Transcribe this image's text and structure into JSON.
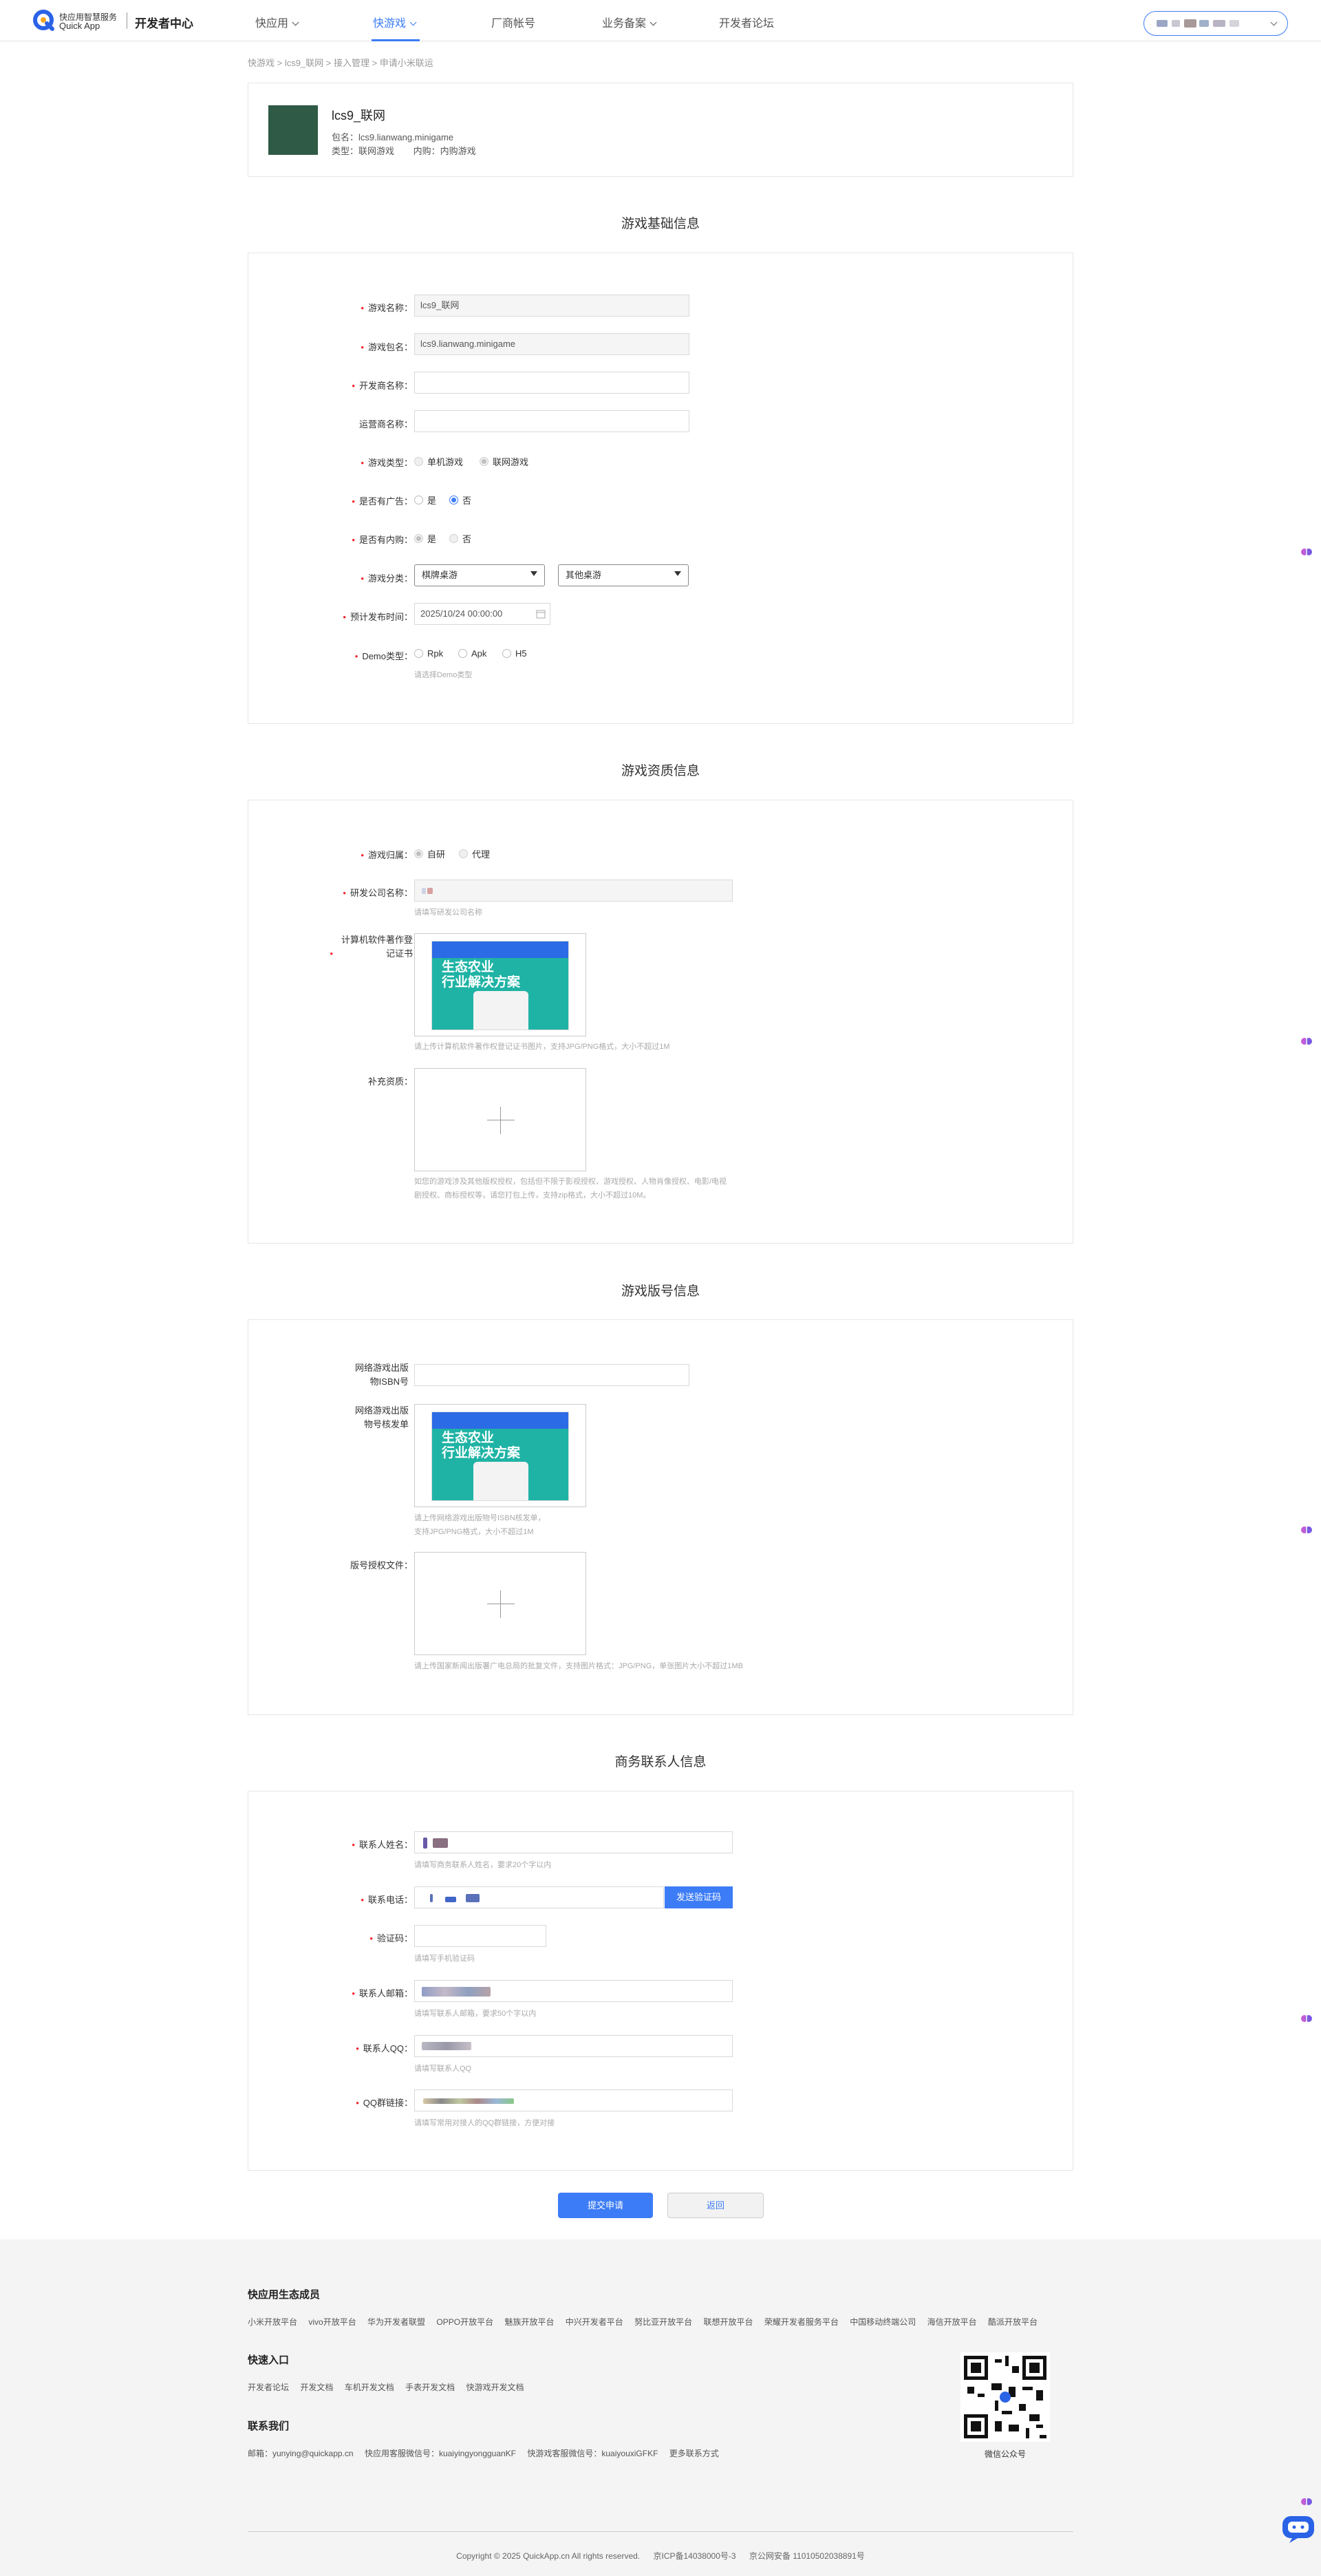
{
  "header": {
    "logo_line1": "快应用智慧服务",
    "logo_line2": "Quick App",
    "center": "开发者中心",
    "nav": [
      {
        "label": "快应用",
        "has_chevron": true
      },
      {
        "label": "快游戏",
        "has_chevron": true,
        "active": true
      },
      {
        "label": "厂商帐号",
        "has_chevron": false
      },
      {
        "label": "业务备案",
        "has_chevron": true
      },
      {
        "label": "开发者论坛",
        "has_chevron": false
      }
    ],
    "accent": "#3c7cf6"
  },
  "breadcrumb": "快游戏 > lcs9_联网 > 接入管理 > 申请小米联运",
  "app": {
    "name": "lcs9_联网",
    "package_line": "包名：lcs9.lianwang.minigame",
    "type_label": "类型：",
    "type_value": "联网游戏",
    "purchase_label": "内购：",
    "purchase_value": "内购游戏"
  },
  "basic": {
    "title": "游戏基础信息",
    "game_name_label": "游戏名称：",
    "game_name_value": "lcs9_联网",
    "package_label": "游戏包名：",
    "package_value": "lcs9.lianwang.minigame",
    "developer_label": "开发商名称：",
    "operator_label": "运营商名称：",
    "type_label": "游戏类型：",
    "type_options": [
      "单机游戏",
      "联网游戏"
    ],
    "ads_label": "是否有广告：",
    "ads_options": [
      "是",
      "否"
    ],
    "iap_label": "是否有内购：",
    "iap_options": [
      "是",
      "否"
    ],
    "category_label": "游戏分类：",
    "category_primary": "棋牌桌游",
    "category_secondary": "其他桌游",
    "release_label": "预计发布时间：",
    "release_value": "2025/10/24 00:00:00",
    "demo_label": "Demo类型：",
    "demo_options": [
      "Rpk",
      "Apk",
      "H5"
    ],
    "demo_hint": "请选择Demo类型"
  },
  "qualification": {
    "title": "游戏资质信息",
    "ownership_label": "游戏归属：",
    "ownership_options": [
      "自研",
      "代理"
    ],
    "company_label": "研发公司名称：",
    "company_hint": "请填写研发公司名称",
    "copyright_label": "计算机软件著作登记证书",
    "copyright_hint": "请上传计算机软件著作权登记证书图片，支持JPG/PNG格式，大小不超过1M",
    "extra_label": "补充资质：",
    "extra_hint_1": "如您的游戏涉及其他版权授权，包括但不限于影视授权、游戏授权、人物肖像授权、电影/电视",
    "extra_hint_2": "剧授权、商标授权等，请您打包上传，支持zip格式，大小不超过10M。",
    "thumb_text_1": "生态农业",
    "thumb_text_2": "行业解决方案"
  },
  "license": {
    "title": "游戏版号信息",
    "isbn_label_1": "网络游戏出版",
    "isbn_label_2": "物ISBN号",
    "approval_label_1": "网络游戏出版",
    "approval_label_2": "物号核发单",
    "approval_hint_1": "请上传网络游戏出版物号ISBN核发单，",
    "approval_hint_2": "支持JPG/PNG格式，大小不超过1M",
    "auth_label": "版号授权文件：",
    "auth_hint": "请上传国家新闻出版署广电总局的批复文件，支持图片格式：JPG/PNG，单张图片大小不超过1MB"
  },
  "contact": {
    "title": "商务联系人信息",
    "name_label": "联系人姓名：",
    "name_hint": "请填写商务联系人姓名，要求20个字以内",
    "phone_label": "联系电话：",
    "send_code_button": "发送验证码",
    "code_label": "验证码：",
    "code_hint": "请填写手机验证码",
    "email_label": "联系人邮箱：",
    "email_hint": "请填写联系人邮箱，要求50个字以内",
    "qq_label": "联系人QQ：",
    "qq_hint": "请填写联系人QQ",
    "qq_group_label": "QQ群链接：",
    "qq_group_hint": "请填写常用对接人的QQ群链接，方便对接"
  },
  "actions": {
    "submit": "提交申请",
    "back": "返回"
  },
  "footer": {
    "eco_title": "快应用生态成员",
    "eco_links": [
      "小米开放平台",
      "vivo开放平台",
      "华为开发者联盟",
      "OPPO开放平台",
      "魅族开放平台",
      "中兴开发者平台",
      "努比亚开放平台",
      "联想开放平台",
      "荣耀开发者服务平台",
      "中国移动终端公司",
      "海信开放平台",
      "酷派开放平台"
    ],
    "quick_title": "快速入口",
    "quick_links": [
      "开发者论坛",
      "开发文档",
      "车机开发文档",
      "手表开发文档",
      "快游戏开发文档"
    ],
    "contact_title": "联系我们",
    "contact_items": [
      "邮箱：yunying@quickapp.cn",
      "快应用客服微信号：kuaiyingyongguanKF",
      "快游戏客服微信号：kuaiyouxiGFKF",
      "更多联系方式"
    ],
    "qr_caption": "微信公众号",
    "copyright": "Copyright © 2025 QuickApp.cn All rights reserved.",
    "icp": "京ICP备14038000号-3",
    "police": "京公网安备 11010502038891号"
  }
}
